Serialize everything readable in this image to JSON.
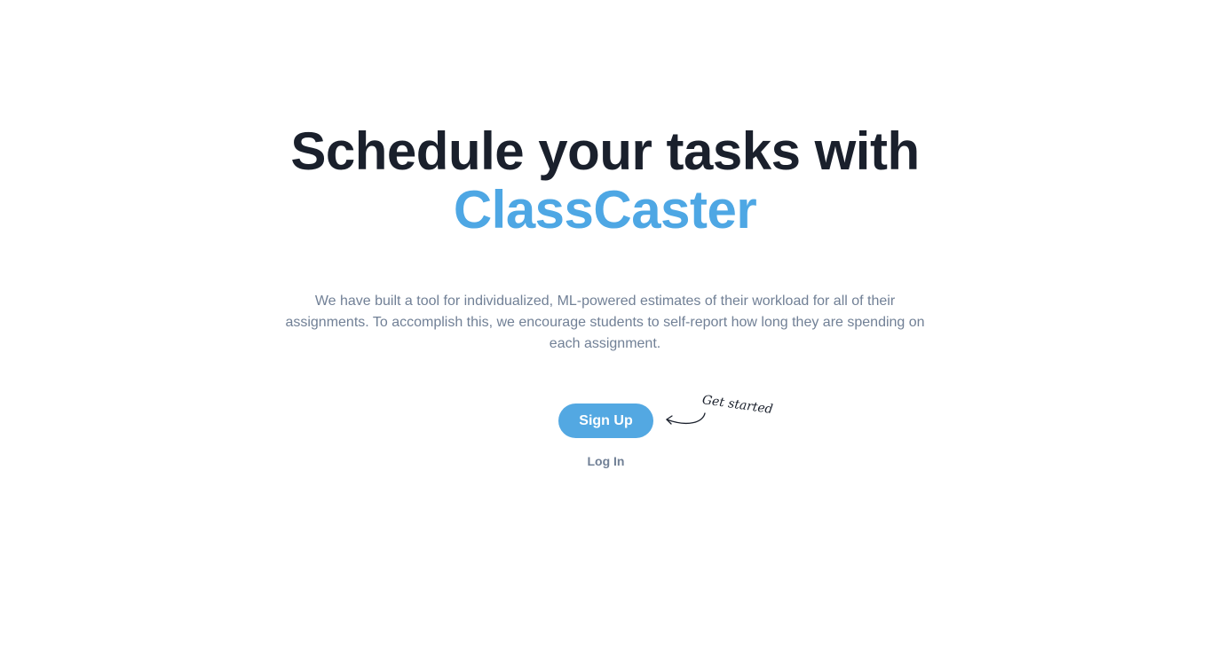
{
  "hero": {
    "title_line1": "Schedule your tasks with",
    "title_brand": "ClassCaster",
    "description": "We have built a tool for individualized, ML-powered estimates of their workload for all of their assignments. To accomplish this, we encourage students to self-report how long they are spending on each assignment."
  },
  "actions": {
    "signup_label": "Sign Up",
    "login_label": "Log In",
    "annotation": "Get started",
    "annotation_icon": "curved-arrow-left-icon"
  },
  "colors": {
    "brand": "#4ea7e4",
    "button": "#53a8e2",
    "heading": "#1a202c",
    "muted": "#718096"
  }
}
